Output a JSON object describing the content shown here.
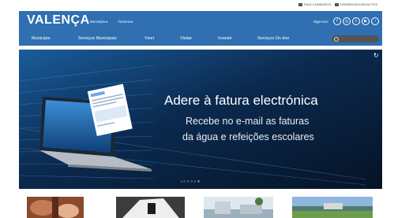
{
  "utility": {
    "contact": "FALE CONNOSCO",
    "hours": "HORÁRIOS/CONTACTOS"
  },
  "header": {
    "logo": "VALENÇA",
    "links": [
      "Município",
      "Turismo"
    ],
    "follow_label": "Siga-nos:",
    "social": [
      {
        "icon": "facebook-icon",
        "glyph": "f"
      },
      {
        "icon": "instagram-icon",
        "glyph": "◎"
      },
      {
        "icon": "twitter-icon",
        "glyph": "t"
      },
      {
        "icon": "youtube-icon",
        "glyph": "▶"
      },
      {
        "icon": "rss-icon",
        "glyph": "◔"
      }
    ]
  },
  "nav": {
    "items": [
      "Município",
      "Serviços Municipais",
      "Viver",
      "Visitar",
      "Investir",
      "Serviços On-line"
    ],
    "search_placeholder": ""
  },
  "banner": {
    "title": "Adere à fatura electrónica",
    "subtitle_line1": "Recebe no e-mail as faturas",
    "subtitle_line2": "da água e refeições escolares",
    "pager": "› ○ ○ ○ ○ ॥"
  },
  "colors": {
    "brand": "#2f6fb2",
    "banner_bg": "#071729"
  }
}
